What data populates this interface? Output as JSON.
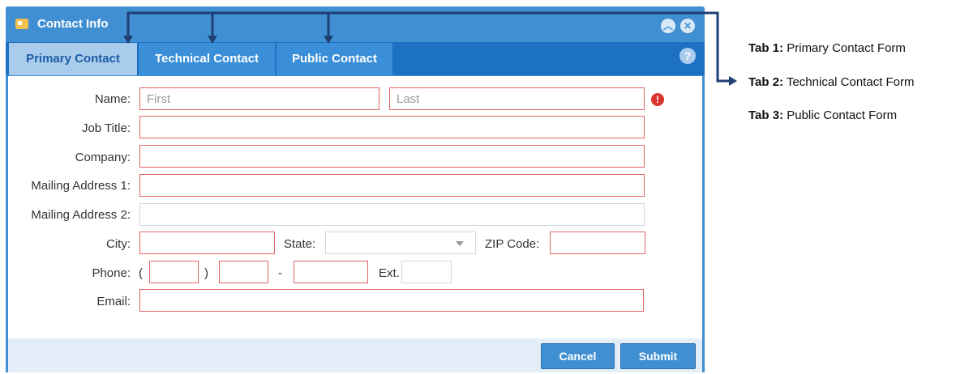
{
  "dialog": {
    "title": "Contact Info",
    "tabs": [
      {
        "label": "Primary Contact",
        "active": true
      },
      {
        "label": "Technical Contact",
        "active": false
      },
      {
        "label": "Public Contact",
        "active": false
      }
    ]
  },
  "form": {
    "name_label": "Name:",
    "first_placeholder": "First",
    "last_placeholder": "Last",
    "job_title_label": "Job Title:",
    "company_label": "Company:",
    "address1_label": "Mailing Address 1:",
    "address2_label": "Mailing Address 2:",
    "city_label": "City:",
    "state_label": "State:",
    "zip_label": "ZIP Code:",
    "phone_label": "Phone:",
    "phone_open_paren": "(",
    "phone_close_paren": ")",
    "phone_dash": "-",
    "ext_label": "Ext.",
    "email_label": "Email:"
  },
  "buttons": {
    "cancel": "Cancel",
    "submit": "Submit"
  },
  "annotations": [
    {
      "key": "Tab 1:",
      "text": " Primary Contact Form"
    },
    {
      "key": "Tab 2:",
      "text": " Technical Contact Form"
    },
    {
      "key": "Tab 3:",
      "text": " Public Contact Form"
    }
  ],
  "colors": {
    "titlebar": "#3f8fd2",
    "tabbar": "#1c71c4",
    "active_tab": "#a9ccec",
    "error_border": "#e06666",
    "arrow": "#1f3f73"
  }
}
